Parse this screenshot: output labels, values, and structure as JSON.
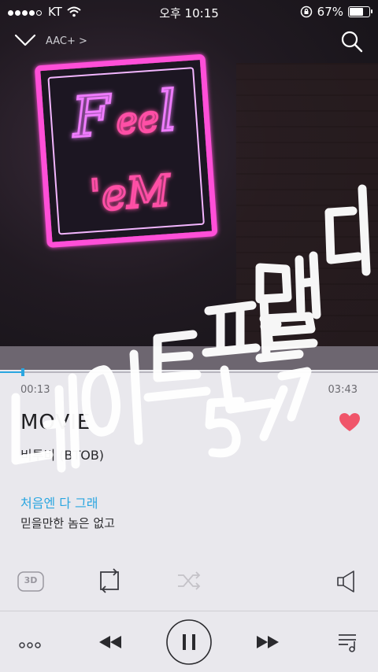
{
  "status": {
    "carrier": "KT",
    "time": "오후 10:15",
    "battery_pct": "67%",
    "battery_level": 0.67
  },
  "topbar": {
    "quality": "AAC+ >"
  },
  "player": {
    "elapsed": "00:13",
    "duration": "03:43",
    "progress": 0.06,
    "title": "MOVIE",
    "artist": "비투비 (BTOB)",
    "liked": true
  },
  "lyrics": {
    "current": "처음엔 다 그래",
    "next": "믿을만한 놈은 없고"
  },
  "controls": {
    "mode_3d": "3D"
  },
  "colors": {
    "accent": "#2aa6e0",
    "heart": "#f0556a",
    "neon": "#ff4fd8"
  },
  "icons": [
    "chevron-down-icon",
    "search-icon",
    "heart-icon",
    "3d-icon",
    "repeat-icon",
    "shuffle-icon",
    "volume-icon",
    "more-icon",
    "previous-icon",
    "pause-icon",
    "next-icon",
    "playlist-icon"
  ]
}
